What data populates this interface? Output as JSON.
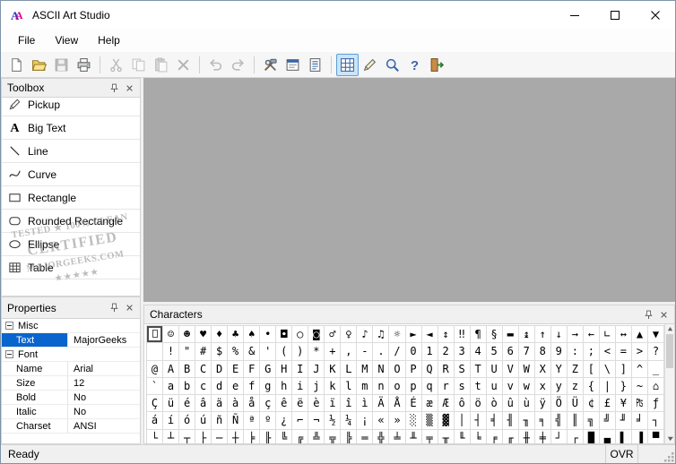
{
  "window": {
    "title": "ASCII Art Studio"
  },
  "menu": {
    "items": [
      "File",
      "View",
      "Help"
    ]
  },
  "toolbar": {
    "buttons": [
      {
        "icon": "new-icon",
        "state": "enabled"
      },
      {
        "icon": "open-icon",
        "state": "enabled"
      },
      {
        "icon": "save-icon",
        "state": "disabled"
      },
      {
        "icon": "print-icon",
        "state": "enabled"
      },
      {
        "icon": "separator"
      },
      {
        "icon": "cut-icon",
        "state": "disabled"
      },
      {
        "icon": "copy-icon",
        "state": "disabled"
      },
      {
        "icon": "paste-icon",
        "state": "disabled"
      },
      {
        "icon": "delete-icon",
        "state": "disabled"
      },
      {
        "icon": "separator"
      },
      {
        "icon": "undo-icon",
        "state": "disabled"
      },
      {
        "icon": "redo-icon",
        "state": "disabled"
      },
      {
        "icon": "separator"
      },
      {
        "icon": "tools-icon",
        "state": "enabled"
      },
      {
        "icon": "form-icon",
        "state": "enabled"
      },
      {
        "icon": "textdoc-icon",
        "state": "enabled"
      },
      {
        "icon": "separator"
      },
      {
        "icon": "grid-icon",
        "state": "toggled"
      },
      {
        "icon": "pen-icon",
        "state": "enabled"
      },
      {
        "icon": "zoom-icon",
        "state": "enabled"
      },
      {
        "icon": "help-icon",
        "state": "enabled"
      },
      {
        "icon": "exit-icon",
        "state": "enabled"
      }
    ]
  },
  "toolbox": {
    "title": "Toolbox",
    "items": [
      {
        "icon": "pickup-icon",
        "label": "Pickup"
      },
      {
        "icon": "big-text-icon",
        "label": "Big Text"
      },
      {
        "icon": "line-icon",
        "label": "Line"
      },
      {
        "icon": "curve-icon",
        "label": "Curve"
      },
      {
        "icon": "rectangle-icon",
        "label": "Rectangle"
      },
      {
        "icon": "rounded-rectangle-icon",
        "label": "Rounded Rectangle"
      },
      {
        "icon": "ellipse-icon",
        "label": "Ellipse"
      },
      {
        "icon": "table-icon",
        "label": "Table"
      }
    ]
  },
  "properties": {
    "title": "Properties",
    "rows": [
      {
        "type": "group",
        "label": "Misc"
      },
      {
        "type": "prop",
        "name": "Text",
        "value": "MajorGeeks",
        "selected": true
      },
      {
        "type": "group",
        "label": "Font"
      },
      {
        "type": "prop",
        "name": "Name",
        "value": "Arial"
      },
      {
        "type": "prop",
        "name": "Size",
        "value": "12"
      },
      {
        "type": "prop",
        "name": "Bold",
        "value": "No"
      },
      {
        "type": "prop",
        "name": "Italic",
        "value": "No"
      },
      {
        "type": "prop",
        "name": "Charset",
        "value": "ANSI"
      }
    ]
  },
  "characters": {
    "title": "Characters",
    "selected_index": 0,
    "columns": 32,
    "rows": [
      " ☺☻♥♦♣♠•◘○◙♂♀♪♫☼►◄↕‼¶§▬↨↑↓→←∟↔▲▼",
      " !\"#$%&'()*+,-./0123456789:;<=>?",
      "@ABCDEFGHIJKLMNOPQRSTUVWXYZ[\\]^_",
      "`abcdefghijklmnopqrstuvwxyz{|}~⌂",
      "ÇüéâäàåçêëèïîìÄÅÉæÆôöòûùÿÖÜ¢£¥₧ƒ",
      "áíóúñÑªº¿⌐¬½¼¡«»░▒▓│┤╡╢╖╕╣║╗╝╜╛┐",
      "└┴┬├─┼╞╟╚╔╩╦╠═╬╧╨╤╥╙╘╒╓╫╪┘┌█▄▌▐▀"
    ]
  },
  "statusbar": {
    "status": "Ready",
    "ovr": "OVR"
  },
  "watermark": {
    "line1": "TESTED ★ 100% CLEAN",
    "line2": "CERTIFIED",
    "line3": "MAJORGEEKS.COM",
    "stars": "★★★★★"
  },
  "colors": {
    "accent": "#0a64cd",
    "canvas_gray": "#a9a9a9",
    "toggle_bg": "#cce4f7",
    "toggle_border": "#5ba0dc"
  }
}
